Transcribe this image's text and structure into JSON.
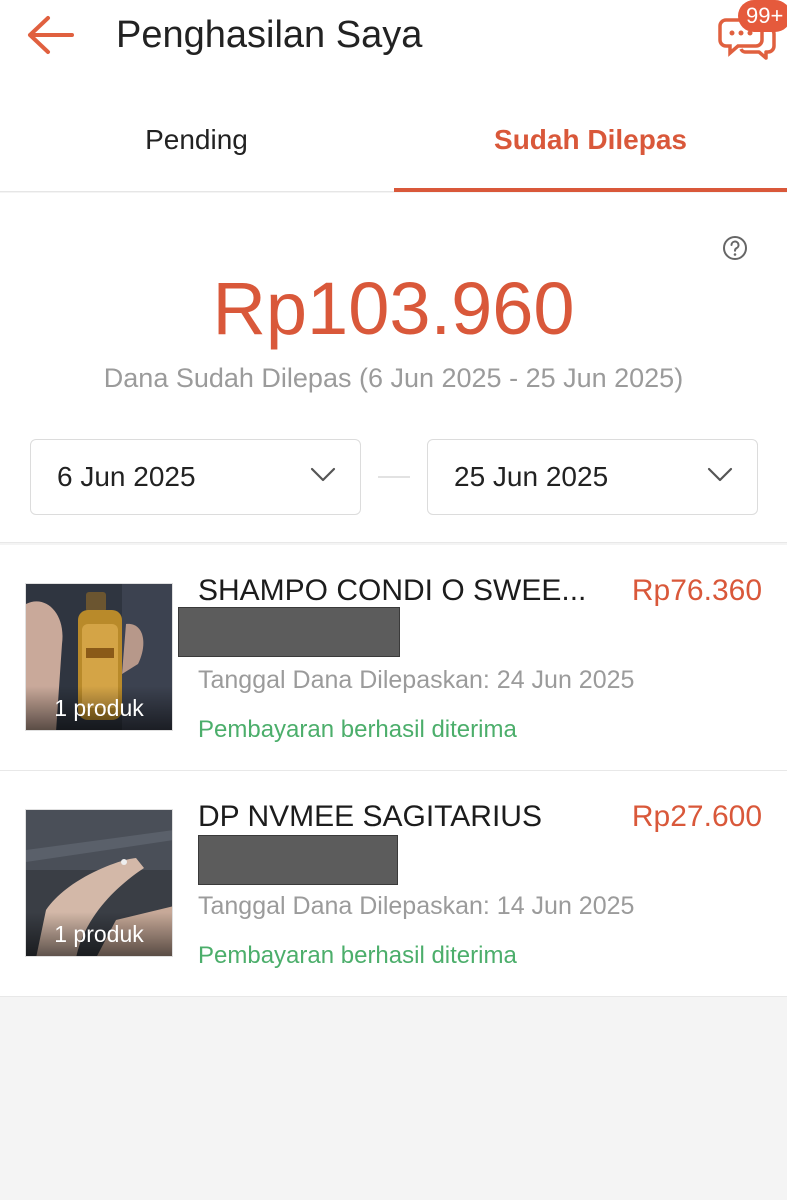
{
  "header": {
    "title": "Penghasilan Saya",
    "back_icon": "arrow-left-icon",
    "chat_icon": "chat-bubbles-icon",
    "chat_badge": "99+"
  },
  "tabs": [
    {
      "label": "Pending",
      "active": false
    },
    {
      "label": "Sudah Dilepas",
      "active": true
    }
  ],
  "summary": {
    "total": "Rp103.960",
    "period_text": "Dana Sudah Dilepas (6 Jun 2025 - 25 Jun 2025)",
    "help_icon": "question-circle-icon",
    "start_date": "6 Jun 2025",
    "end_date": "25 Jun 2025"
  },
  "transactions": [
    {
      "product_name": "SHAMPO CONDI O SWEE...",
      "amount": "Rp76.360",
      "quantity": "1 produk",
      "release_date": "Tanggal Dana Dilepaskan: 24 Jun 2025",
      "status": "Pembayaran berhasil diterima"
    },
    {
      "product_name": "DP NVMEE SAGITARIUS",
      "amount": "Rp27.600",
      "quantity": "1 produk",
      "release_date": "Tanggal Dana Dilepaskan: 14 Jun 2025",
      "status": "Pembayaran berhasil diterima"
    }
  ],
  "colors": {
    "accent": "#d9583a",
    "success": "#4cae6b",
    "muted": "#9b9b9b"
  }
}
